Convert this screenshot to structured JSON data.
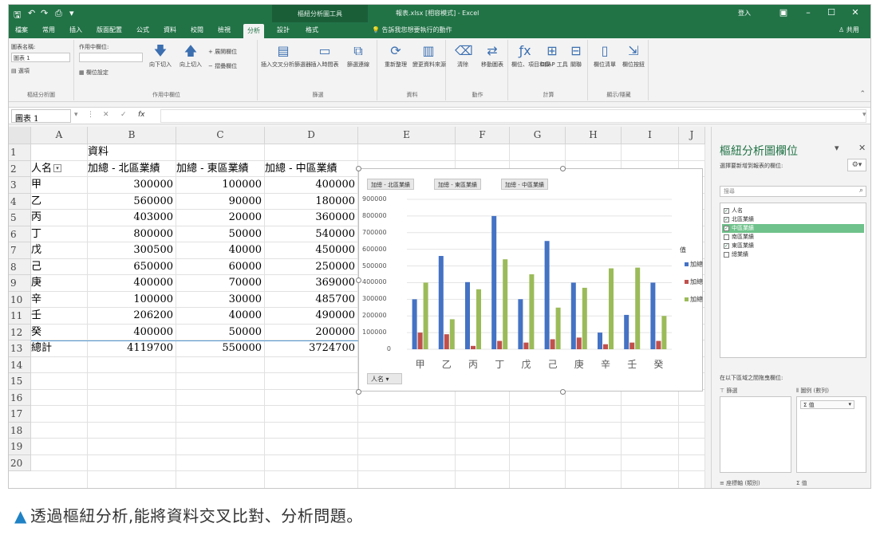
{
  "window": {
    "title": "報表.xlsx [相容模式] - Excel",
    "context_group": "樞紐分析圖工具",
    "signin": "登入"
  },
  "ribbon_tabs": [
    "檔案",
    "常用",
    "插入",
    "版面配置",
    "公式",
    "資料",
    "校閱",
    "檢視",
    "分析",
    "設計",
    "格式"
  ],
  "active_tab": "分析",
  "tell_me": "告訴我您想要執行的動作",
  "share": "共用",
  "ribbon": {
    "groups": [
      {
        "label": "樞紐分析圖",
        "items": [
          "圖表名稱:",
          "圖表 1",
          "選項"
        ]
      },
      {
        "label": "作用中欄位",
        "items": [
          "作用中欄位:",
          "欄位設定",
          "向下切入",
          "向上切入",
          "展開欄位",
          "摺疊欄位"
        ]
      },
      {
        "label": "篩選",
        "items": [
          "插入交叉分析篩選器",
          "插入時間表",
          "篩選連線"
        ]
      },
      {
        "label": "資料",
        "items": [
          "重新整理",
          "變更資料來源"
        ]
      },
      {
        "label": "動作",
        "items": [
          "清除",
          "移動圖表"
        ]
      },
      {
        "label": "計算",
        "items": [
          "欄位、項目和集",
          "OLAP 工具",
          "關聯"
        ]
      },
      {
        "label": "顯示/隱藏",
        "items": [
          "欄位清單",
          "欄位按鈕"
        ]
      }
    ]
  },
  "formula_bar": {
    "name_box": "圖表 1",
    "fx": "fx",
    "value": ""
  },
  "grid": {
    "columns": [
      "A",
      "B",
      "C",
      "D",
      "E",
      "F",
      "G",
      "H",
      "I",
      "J"
    ],
    "rows": [
      "1",
      "2",
      "3",
      "4",
      "5",
      "6",
      "7",
      "8",
      "9",
      "10",
      "11",
      "12",
      "13",
      "14",
      "15",
      "16",
      "17",
      "18",
      "19",
      "20"
    ],
    "header_row1": "資料",
    "headers": [
      "人名",
      "加總 - 北區業績",
      "加總 - 東區業績",
      "加總 - 中區業績"
    ],
    "data": [
      [
        "甲",
        "300000",
        "100000",
        "400000"
      ],
      [
        "乙",
        "560000",
        "90000",
        "180000"
      ],
      [
        "丙",
        "403000",
        "20000",
        "360000"
      ],
      [
        "丁",
        "800000",
        "50000",
        "540000"
      ],
      [
        "戊",
        "300500",
        "40000",
        "450000"
      ],
      [
        "己",
        "650000",
        "60000",
        "250000"
      ],
      [
        "庚",
        "400000",
        "70000",
        "369000"
      ],
      [
        "辛",
        "100000",
        "30000",
        "485700"
      ],
      [
        "壬",
        "206200",
        "40000",
        "490000"
      ],
      [
        "癸",
        "400000",
        "50000",
        "200000"
      ]
    ],
    "total": [
      "總計",
      "4119700",
      "550000",
      "3724700"
    ]
  },
  "chart_data": {
    "type": "bar",
    "field_buttons": [
      "加總 - 北區業績",
      "加總 - 東區業績",
      "加總 - 中區業績"
    ],
    "axis_field_button": "人名",
    "categories": [
      "甲",
      "乙",
      "丙",
      "丁",
      "戊",
      "己",
      "庚",
      "辛",
      "壬",
      "癸"
    ],
    "series": [
      {
        "name": "加總 - 北區業績",
        "color": "#4472c4",
        "values": [
          300000,
          560000,
          403000,
          800000,
          300500,
          650000,
          400000,
          100000,
          206200,
          400000
        ]
      },
      {
        "name": "加總 - 東區業績",
        "color": "#c0504d",
        "values": [
          100000,
          90000,
          20000,
          50000,
          40000,
          60000,
          70000,
          30000,
          40000,
          50000
        ]
      },
      {
        "name": "加總 - 中區業績",
        "color": "#9bbb59",
        "values": [
          400000,
          180000,
          360000,
          540000,
          450000,
          250000,
          369000,
          485700,
          490000,
          200000
        ]
      }
    ],
    "ylim": [
      0,
      900000
    ],
    "yticks": [
      "900000",
      "800000",
      "700000",
      "600000",
      "500000",
      "400000",
      "300000",
      "200000",
      "100000",
      "0"
    ],
    "legend_title": "值",
    "legend_labels": [
      "加總",
      "加總",
      "加總"
    ],
    "legend_position": "right",
    "grid": true
  },
  "pivot_pane": {
    "title": "樞紐分析圖欄位",
    "subtitle": "選擇要新增到報表的欄位:",
    "search_placeholder": "搜尋",
    "fields": [
      {
        "label": "人名",
        "checked": true,
        "selected": false
      },
      {
        "label": "北區業績",
        "checked": true,
        "selected": false
      },
      {
        "label": "中區業績",
        "checked": true,
        "selected": true
      },
      {
        "label": "南區業績",
        "checked": false,
        "selected": false
      },
      {
        "label": "東區業績",
        "checked": true,
        "selected": false
      },
      {
        "label": "總業績",
        "checked": false,
        "selected": false
      }
    ],
    "areas_label": "在以下區域之間拖曳欄位:",
    "filters_label": "篩選",
    "legend_label": "圖例 (數列)",
    "legend_item": "Σ 值",
    "axis_label": "座標軸 (類別)",
    "values_label": "Σ 值"
  },
  "caption": {
    "mark": "▲",
    "text": "透過樞紐分析,能將資料交叉比對、分析問題。"
  }
}
